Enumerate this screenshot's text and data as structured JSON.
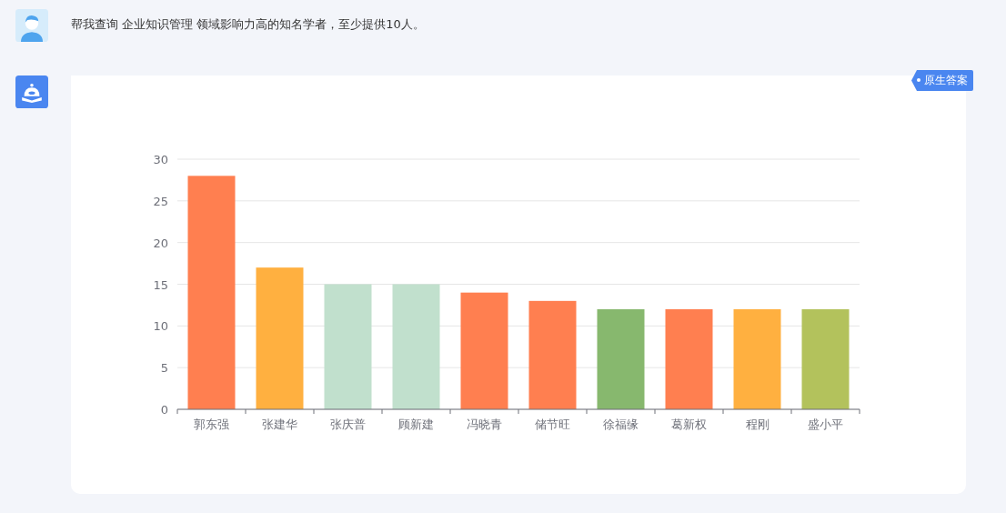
{
  "question": {
    "text": "帮我查询 企业知识管理 领域影响力高的知名学者，至少提供10人。"
  },
  "answer": {
    "badge": "原生答案",
    "chart_data": {
      "type": "bar",
      "categories": [
        "郭东强",
        "张建华",
        "张庆普",
        "顾新建",
        "冯晓青",
        "储节旺",
        "徐福缘",
        "葛新权",
        "程刚",
        "盛小平"
      ],
      "stacked": true,
      "grid": true,
      "ylim": [
        0,
        30
      ],
      "yticks": [
        0,
        5,
        10,
        15,
        20,
        25,
        30
      ],
      "series": [
        {
          "color": "#ff7f50",
          "values": [
            28,
            null,
            null,
            null,
            14,
            13,
            null,
            12,
            null,
            null
          ]
        },
        {
          "color": "#ffb040",
          "values": [
            null,
            17,
            null,
            null,
            null,
            null,
            null,
            null,
            12,
            null
          ]
        },
        {
          "color": "#c1e0cd",
          "values": [
            null,
            null,
            15,
            15,
            null,
            null,
            null,
            null,
            null,
            null
          ]
        },
        {
          "color": "#87b86e",
          "values": [
            null,
            null,
            null,
            null,
            null,
            null,
            12,
            null,
            null,
            null
          ]
        },
        {
          "color": "#b3c25c",
          "values": [
            null,
            null,
            null,
            null,
            null,
            null,
            null,
            null,
            null,
            12
          ]
        }
      ]
    }
  }
}
